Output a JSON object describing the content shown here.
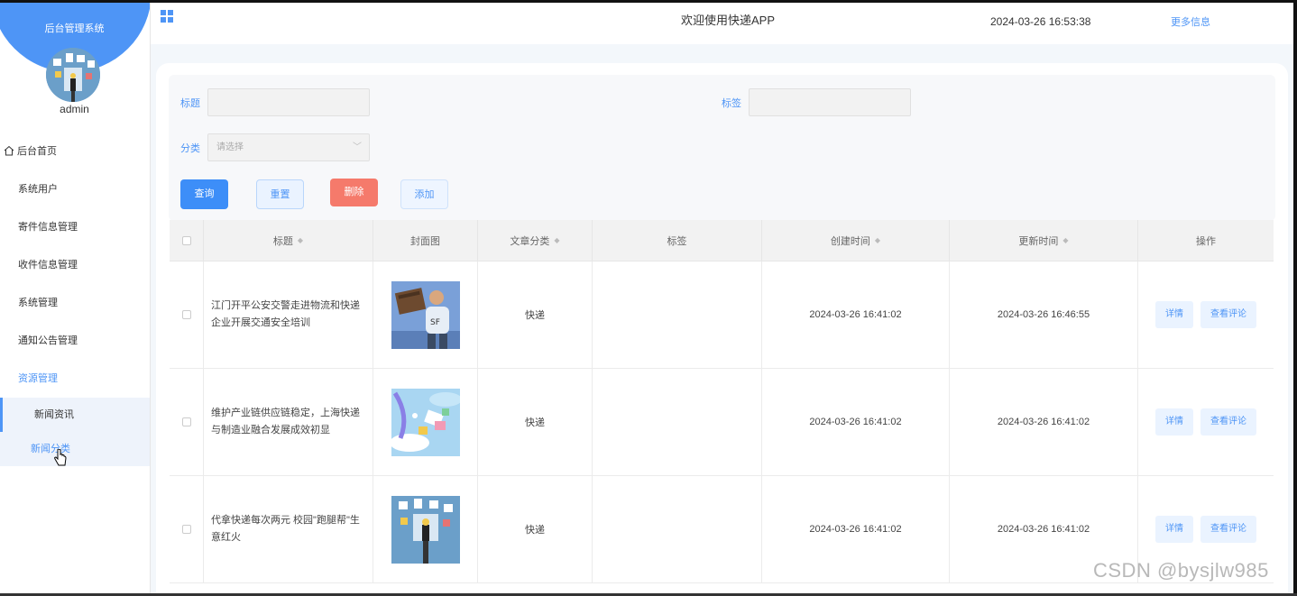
{
  "sidebar": {
    "system_title": "后台管理系统",
    "username": "admin",
    "items": [
      {
        "label": "后台首页"
      },
      {
        "label": "系统用户"
      },
      {
        "label": "寄件信息管理"
      },
      {
        "label": "收件信息管理"
      },
      {
        "label": "系统管理"
      },
      {
        "label": "通知公告管理"
      },
      {
        "label": "资源管理"
      }
    ],
    "subitems": [
      {
        "label": "新闻资讯"
      },
      {
        "label": "新闻分类"
      }
    ]
  },
  "header": {
    "welcome": "欢迎使用快递APP",
    "datetime": "2024-03-26 16:53:38",
    "more_info": "更多信息"
  },
  "search": {
    "title_label": "标题",
    "tag_label": "标签",
    "category_label": "分类",
    "category_placeholder": "请选择",
    "query_button": "查询",
    "reset_button": "重置",
    "delete_button": "删除",
    "add_button": "添加"
  },
  "table": {
    "headers": [
      "标题",
      "封面图",
      "文章分类",
      "标签",
      "创建时间",
      "更新时间",
      "操作"
    ],
    "rows": [
      {
        "title": "江门开平公安交警走进物流和快递企业开展交通安全培训",
        "category": "快递",
        "tag": "",
        "created": "2024-03-26 16:41:02",
        "updated": "2024-03-26 16:46:55",
        "detail": "详情",
        "comments": "查看评论"
      },
      {
        "title": "维护产业链供应链稳定，上海快递与制造业融合发展成效初显",
        "category": "快递",
        "tag": "",
        "created": "2024-03-26 16:41:02",
        "updated": "2024-03-26 16:41:02",
        "detail": "详情",
        "comments": "查看评论"
      },
      {
        "title": "代拿快递每次两元 校园\"跑腿帮\"生意红火",
        "category": "快递",
        "tag": "",
        "created": "2024-03-26 16:41:02",
        "updated": "2024-03-26 16:41:02",
        "detail": "详情",
        "comments": "查看评论"
      }
    ]
  },
  "watermark": "CSDN @bysjlw985",
  "colors": {
    "accent": "#4e95f6",
    "danger": "#f57a6b",
    "primary_button": "#3d8ef8"
  }
}
